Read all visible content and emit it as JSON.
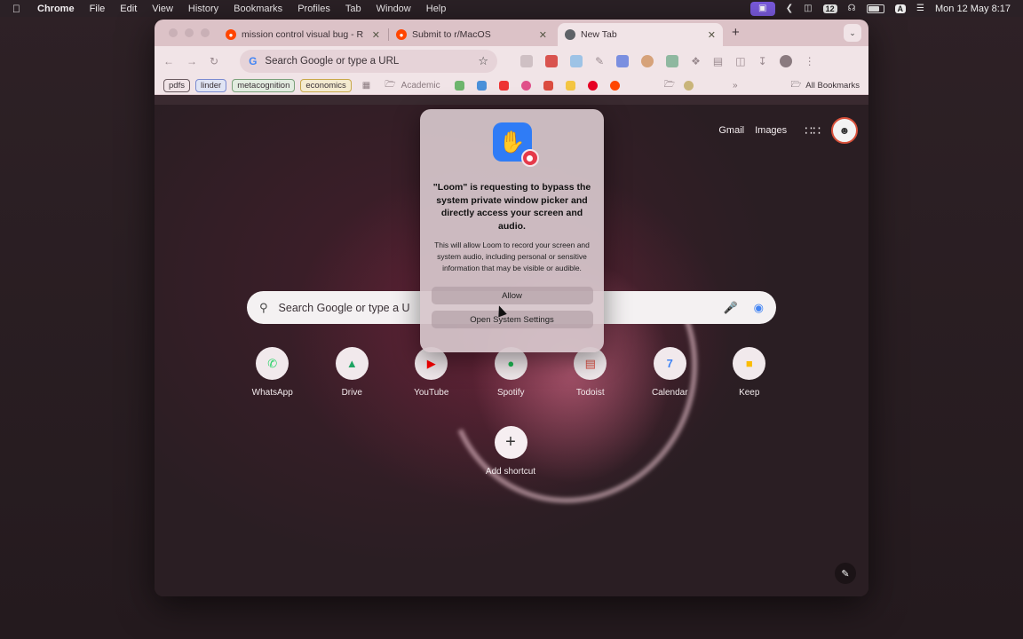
{
  "menubar": {
    "app_name": "Chrome",
    "items": [
      "File",
      "Edit",
      "View",
      "History",
      "Bookmarks",
      "Profiles",
      "Tab",
      "Window",
      "Help"
    ],
    "calendar_badge": "12",
    "input_badge": "A",
    "clock": "Mon 12 May  8:17"
  },
  "browser": {
    "tabs": [
      {
        "title": "mission control visual bug - R",
        "favicon_color": "#ff4500"
      },
      {
        "title": "Submit to r/MacOS",
        "favicon_color": "#ff4500"
      },
      {
        "title": "New Tab",
        "favicon_color": "#5f6368"
      }
    ],
    "omnibox_placeholder": "Search Google or type a URL",
    "bookmarks": {
      "chips": [
        "pdfs",
        "linder",
        "metacognition",
        "economics"
      ],
      "folder_academic": "Academic",
      "all_bookmarks": "All Bookmarks"
    }
  },
  "ntp": {
    "gmail": "Gmail",
    "images": "Images",
    "search_placeholder": "Search Google or type a U",
    "shortcuts": [
      {
        "label": "WhatsApp",
        "icon": "whatsapp-icon",
        "color": "#25d366"
      },
      {
        "label": "Drive",
        "icon": "drive-icon",
        "color": "#1fa463"
      },
      {
        "label": "YouTube",
        "icon": "youtube-icon",
        "color": "#ff0000"
      },
      {
        "label": "Spotify",
        "icon": "spotify-icon",
        "color": "#1db954"
      },
      {
        "label": "Todoist",
        "icon": "todoist-icon",
        "color": "#db4c3f"
      },
      {
        "label": "Calendar",
        "icon": "calendar-icon",
        "color": "#4285f4"
      },
      {
        "label": "Keep",
        "icon": "keep-icon",
        "color": "#fbbc04"
      }
    ],
    "add_shortcut": "Add shortcut"
  },
  "dialog": {
    "title": "\"Loom\" is requesting to bypass the system private window picker and directly access your screen and audio.",
    "body": "This will allow Loom to record your screen and system audio, including personal or sensitive information that may be visible or audible.",
    "allow": "Allow",
    "open_settings": "Open System Settings"
  }
}
